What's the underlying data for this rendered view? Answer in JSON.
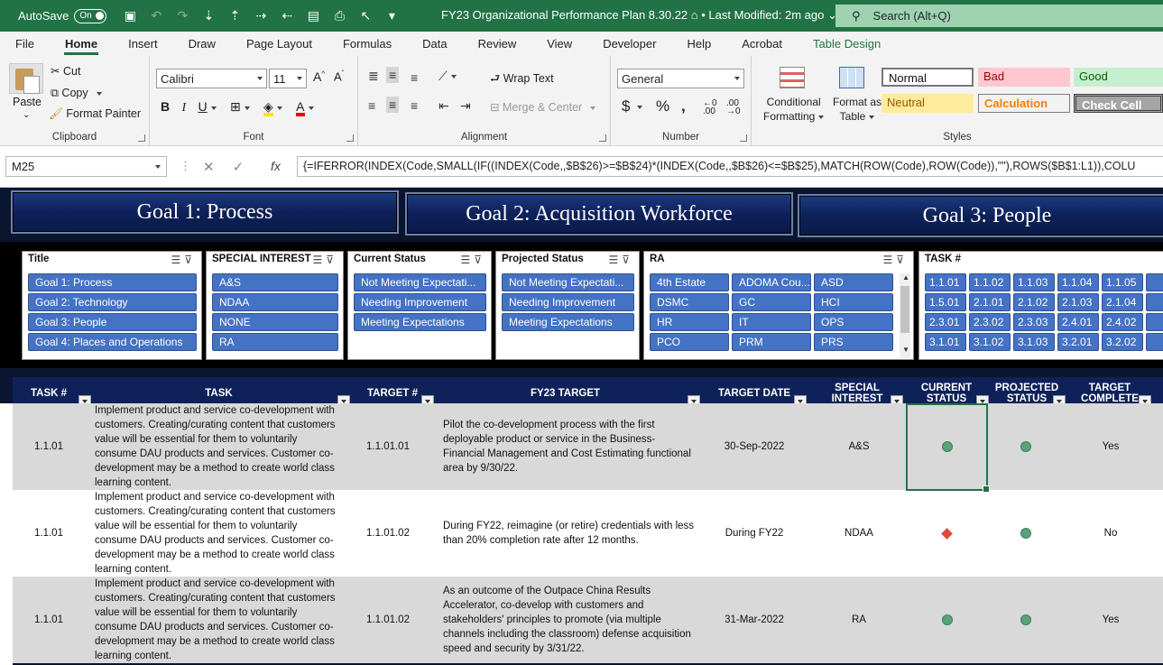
{
  "titlebar": {
    "autosave_label": "AutoSave",
    "autosave_state": "On",
    "doc_title": "FY23 Organizational Performance Plan 8.30.22",
    "modified": "• Last Modified: 2m ago",
    "search_placeholder": "Search (Alt+Q)"
  },
  "menu": [
    "File",
    "Home",
    "Insert",
    "Draw",
    "Page Layout",
    "Formulas",
    "Data",
    "Review",
    "View",
    "Developer",
    "Help",
    "Acrobat",
    "Table Design"
  ],
  "ribbon": {
    "clipboard": {
      "paste": "Paste",
      "cut": "Cut",
      "copy": "Copy",
      "format_painter": "Format Painter",
      "label": "Clipboard"
    },
    "font": {
      "name": "Calibri",
      "size": "11",
      "label": "Font"
    },
    "alignment": {
      "wrap": "Wrap Text",
      "merge": "Merge & Center",
      "label": "Alignment"
    },
    "number": {
      "format": "General",
      "label": "Number"
    },
    "styles": {
      "conditional": "Conditional",
      "conditional2": "Formatting",
      "format_as": "Format as",
      "format_as2": "Table",
      "normal": "Normal",
      "bad": "Bad",
      "good": "Good",
      "neutral": "Neutral",
      "calculation": "Calculation",
      "check": "Check Cell",
      "label": "Styles"
    }
  },
  "formula_bar": {
    "name_box": "M25",
    "fx": "fx",
    "formula": "{=IFERROR(INDEX(Code,SMALL(IF((INDEX(Code,,$B$26)>=$B$24)*(INDEX(Code,,$B$26)<=$B$25),MATCH(ROW(Code),ROW(Code)),\"\"),ROWS($B$1:L1)),COLU"
  },
  "goals": [
    "Goal 1: Process",
    "Goal 2: Acquisition Workforce",
    "Goal 3: People"
  ],
  "slicers": {
    "title": {
      "header": "Title",
      "items": [
        "Goal 1: Process",
        "Goal 2: Technology",
        "Goal 3: People",
        "Goal 4: Places and Operations"
      ]
    },
    "special": {
      "header": "SPECIAL INTEREST",
      "items": [
        "A&S",
        "NDAA",
        "NONE",
        "RA"
      ]
    },
    "current": {
      "header": "Current Status",
      "items": [
        "Not Meeting Expectati...",
        "Needing Improvement",
        "Meeting Expectations"
      ]
    },
    "projected": {
      "header": "Projected Status",
      "items": [
        "Not Meeting Expectati...",
        "Needing Improvement",
        "Meeting Expectations"
      ]
    },
    "ra": {
      "header": "RA",
      "items": [
        "4th Estate",
        "ADOMA Cou...",
        "ASD",
        "DSMC",
        "GC",
        "HCI",
        "HR",
        "IT",
        "OPS",
        "PCO",
        "PRM",
        "PRS"
      ]
    },
    "task": {
      "header": "TASK #",
      "items": [
        "1.1.01",
        "1.1.02",
        "1.1.03",
        "1.1.04",
        "1.1.05",
        "1.5.01",
        "2.1.01",
        "2.1.02",
        "2.1.03",
        "2.1.04",
        "2.3.01",
        "2.3.02",
        "2.3.03",
        "2.4.01",
        "2.4.02",
        "3.1.01",
        "3.1.02",
        "3.1.03",
        "3.2.01",
        "3.2.02"
      ]
    }
  },
  "table": {
    "headers": {
      "task_num": "TASK #",
      "task": "TASK",
      "target_num": "TARGET #",
      "fy23": "FY23 TARGET",
      "target_date": "TARGET DATE",
      "special1": "SPECIAL",
      "special2": "INTEREST",
      "current1": "CURRENT",
      "current2": "STATUS",
      "projected1": "PROJECTED",
      "projected2": "STATUS",
      "complete1": "TARGET",
      "complete2": "COMPLETE"
    },
    "rows": [
      {
        "task_num": "1.1.01",
        "task": "Implement product and service co-development with customers. Creating/curating content that customers value will be essential for them to voluntarily consume DAU products and services. Customer co-development may be a method to create world class learning content.",
        "target_num": "1.1.01.01",
        "fy23": "Pilot the co-development process with the first deployable product or service in the Business-Financial Management and Cost Estimating functional area by 9/30/22.",
        "target_date": "30-Sep-2022",
        "special": "A&S",
        "current": "meeting",
        "projected": "meeting",
        "complete": "Yes"
      },
      {
        "task_num": "1.1.01",
        "task": "Implement product and service co-development with customers. Creating/curating content that customers value will be essential for them to voluntarily consume DAU products and services. Customer co-development may be a method to create world class learning content.",
        "target_num": "1.1.01.02",
        "fy23": "During FY22, reimagine (or retire) credentials with less than 20% completion rate after 12 months.",
        "target_date": "During FY22",
        "special": "NDAA",
        "current": "not-meeting",
        "projected": "meeting",
        "complete": "No"
      },
      {
        "task_num": "1.1.01",
        "task": "Implement product and service co-development with customers. Creating/curating content that customers value will be essential for them to voluntarily consume DAU products and services. Customer co-development may be a method to create world class learning content.",
        "target_num": "1.1.01.02",
        "fy23": "As an outcome of the Outpace China Results Accelerator, co-develop with customers and stakeholders' principles to promote (via multiple channels including the classroom) defense acquisition speed and security by 3/31/22.",
        "target_date": "31-Mar-2022",
        "special": "RA",
        "current": "meeting",
        "projected": "meeting",
        "complete": "Yes"
      }
    ]
  }
}
